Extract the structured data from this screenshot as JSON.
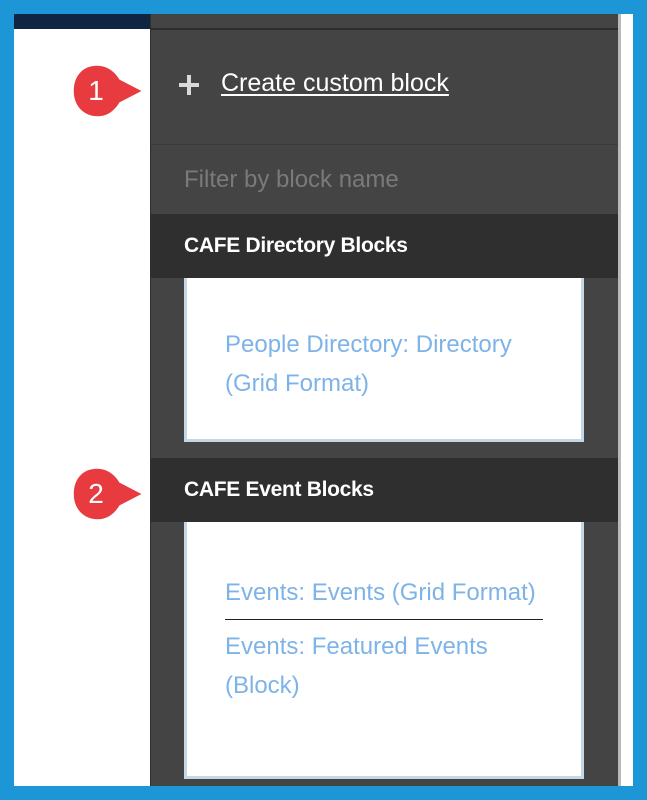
{
  "tray": {
    "create_label": "Create custom block",
    "filter_placeholder": "Filter by block name",
    "categories": [
      {
        "title": "CAFE Directory Blocks",
        "blocks": [
          "People Directory: Directory (Grid Format)"
        ]
      },
      {
        "title": "CAFE Event Blocks",
        "blocks": [
          "Events: Events (Grid Format)",
          "Events: Featured Events (Block)"
        ]
      }
    ]
  },
  "callouts": [
    {
      "number": "1"
    },
    {
      "number": "2"
    }
  ],
  "colors": {
    "frame_border": "#1d96d8",
    "tray_bg": "#444444",
    "category_bg": "#2f2f2f",
    "link": "#7eb3e8",
    "badge": "#e83b3f"
  }
}
